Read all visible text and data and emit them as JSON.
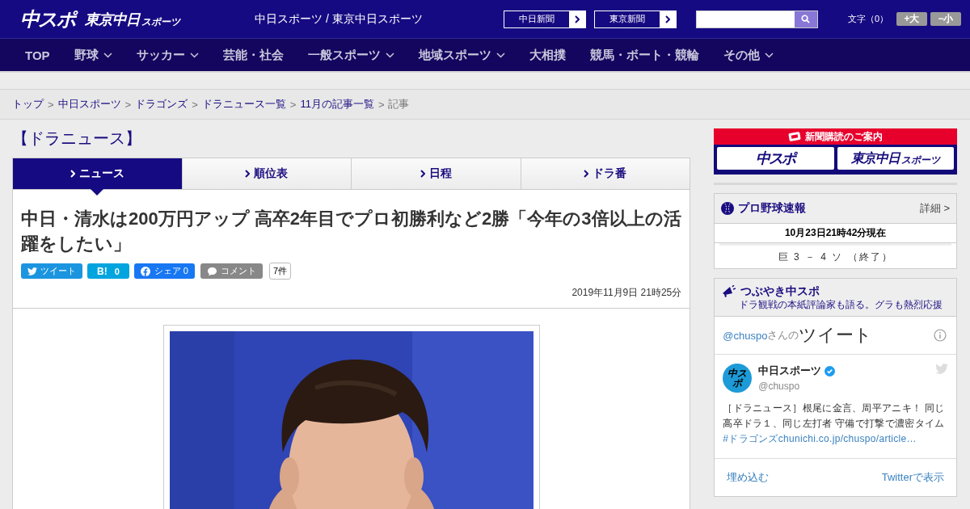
{
  "header": {
    "logo_main": "中スポ",
    "logo_sub": "東京中日",
    "logo_sub_small": "スポーツ",
    "site_title": "中日スポーツ / 東京中日スポーツ",
    "paper_links": [
      "中日新聞",
      "東京新聞"
    ],
    "font_size": {
      "label": "文字（0）",
      "buttons": [
        "+大",
        "−小"
      ]
    }
  },
  "nav": [
    {
      "label": "TOP",
      "dropdown": false
    },
    {
      "label": "野球",
      "dropdown": true
    },
    {
      "label": "サッカー",
      "dropdown": true
    },
    {
      "label": "芸能・社会",
      "dropdown": false
    },
    {
      "label": "一般スポーツ",
      "dropdown": true
    },
    {
      "label": "地域スポーツ",
      "dropdown": true
    },
    {
      "label": "大相撲",
      "dropdown": false
    },
    {
      "label": "競馬・ボート・競輪",
      "dropdown": false
    },
    {
      "label": "その他",
      "dropdown": true
    }
  ],
  "breadcrumb": {
    "separator": ">",
    "items": [
      {
        "label": "トップ",
        "link": true
      },
      {
        "label": "中日スポーツ",
        "link": true
      },
      {
        "label": "ドラゴンズ",
        "link": true
      },
      {
        "label": "ドラニュース一覧",
        "link": true
      },
      {
        "label": "11月の記事一覧",
        "link": true
      },
      {
        "label": "記事",
        "link": false
      }
    ]
  },
  "section_title": "【ドラニュース】",
  "tabs": [
    {
      "label": "ニュース",
      "selected": true
    },
    {
      "label": "順位表",
      "selected": false
    },
    {
      "label": "日程",
      "selected": false
    },
    {
      "label": "ドラ番",
      "selected": false
    }
  ],
  "article": {
    "headline": "中日・清水は200万円アップ 高卒2年目でプロ初勝利など2勝「今年の3倍以上の活躍をしたい」",
    "share": {
      "tweet": "ツイート",
      "hatena_label": "B!",
      "hatena_count": "0",
      "facebook": "シェア",
      "facebook_count": "0",
      "comment": "コメント",
      "comment_count": "7件"
    },
    "date": "2019年11月9日 21時25分"
  },
  "sidebar": {
    "subscribe": {
      "title": "新聞購読のご案内",
      "logo_main": "中スポ",
      "logo_sub": "東京中日",
      "logo_sub_small": "スポーツ"
    },
    "baseball": {
      "title": "プロ野球速報",
      "more": "詳細 >",
      "updated": "10月23日21時42分現在",
      "games": [
        "巨 3 － 4 ソ （終了）"
      ]
    },
    "tweets": {
      "title": "つぶやき中スポ",
      "subtitle": "ドラ観戦の本紙評論家も語る。グラも熱烈応援",
      "handle": "@chuspo",
      "handle_suffix": "さんの",
      "heading": "ツイート",
      "tweet": {
        "avatar_text": "中スポ",
        "name": "中日スポーツ",
        "verified": true,
        "username": "@chuspo",
        "text": "［ドラニュース］根尾に金言、周平アニキ！ 同じ高卒ドラ１、同じ左打者 守備で打撃で濃密タイム",
        "hashtag": "#ドラゴンズ",
        "link": "chunichi.co.jp/chuspo/article…"
      },
      "embed": "埋め込む",
      "view": "Twitterで表示"
    }
  }
}
